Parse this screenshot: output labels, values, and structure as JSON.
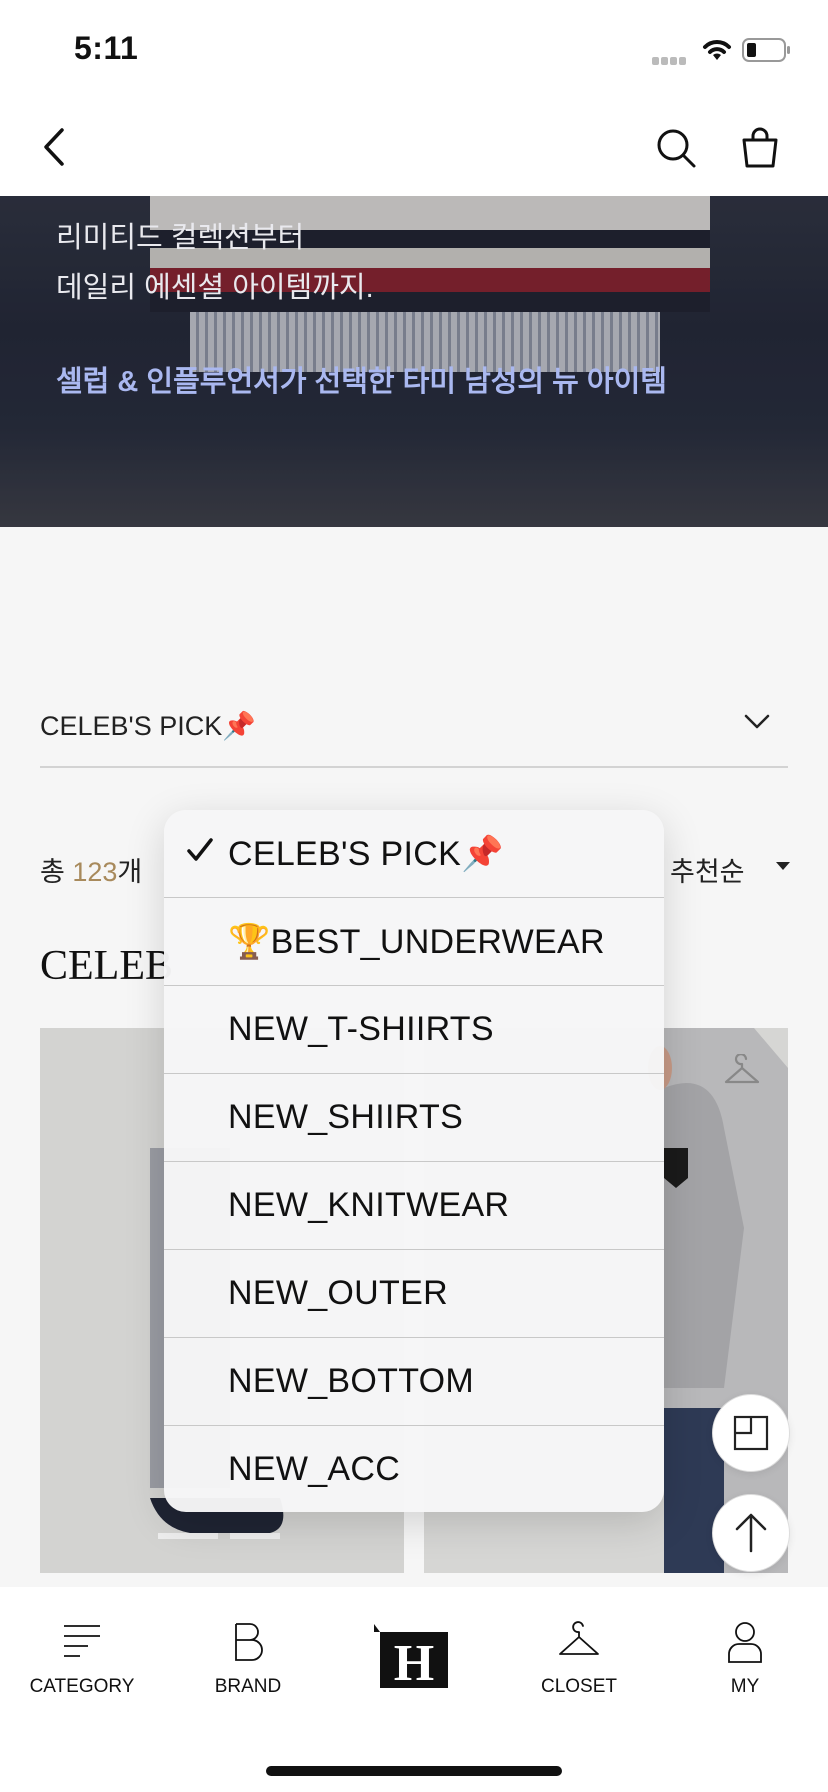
{
  "status_bar": {
    "time": "5:11"
  },
  "banner": {
    "line1": "리미티드 컬렉션부터",
    "line2": "데일리 에센셜 아이템까지.",
    "line3": "셀럽 & 인플루언서가 선택한 타미 남성의 뉴 아이템"
  },
  "category_select": {
    "label": "CELEB'S PICK📌"
  },
  "list": {
    "total_prefix": "총 ",
    "total_count": "123",
    "total_suffix": "개",
    "sort_label": "추천순",
    "section_heading": "CELEB"
  },
  "dropdown": {
    "selected_index": 0,
    "items": [
      {
        "label": "CELEB'S PICK📌"
      },
      {
        "label": "🏆BEST_UNDERWEAR"
      },
      {
        "label": "NEW_T-SHIIRTS"
      },
      {
        "label": "NEW_SHIIRTS"
      },
      {
        "label": "NEW_KNITWEAR"
      },
      {
        "label": "NEW_OUTER"
      },
      {
        "label": "NEW_BOTTOM"
      },
      {
        "label": "NEW_ACC"
      }
    ]
  },
  "tab_bar": {
    "category": "CATEGORY",
    "brand": "BRAND",
    "home": "H",
    "closet": "CLOSET",
    "my": "MY"
  },
  "icons": {
    "back": "chevron-left-icon",
    "search": "search-icon",
    "bag": "shopping-bag-icon",
    "hanger": "hanger-icon",
    "layout": "layout-toggle-icon",
    "top": "arrow-up-icon"
  },
  "colors": {
    "accent": "#a88a5c",
    "banner_highlight": "#aab8f0"
  }
}
